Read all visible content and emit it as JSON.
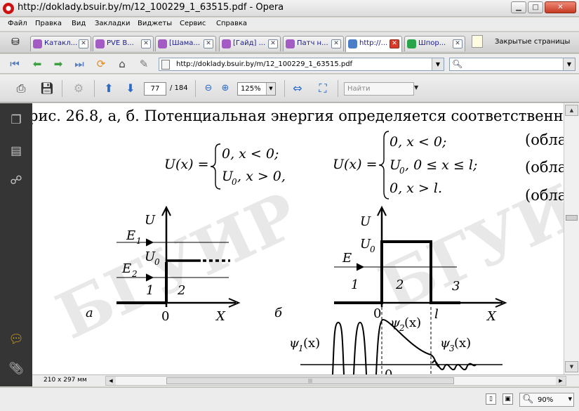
{
  "window": {
    "title": "http://doklady.bsuir.by/m/12_100229_1_63515.pdf - Opera"
  },
  "menu": [
    "Файл",
    "Правка",
    "Вид",
    "Закладки",
    "Виджеты",
    "Сервис",
    "Справка"
  ],
  "tabs": [
    {
      "label": "Катакл..."
    },
    {
      "label": "PVE В..."
    },
    {
      "label": "[Шама..."
    },
    {
      "label": "[Гайд] ..."
    },
    {
      "label": "Патч н..."
    },
    {
      "label": "http://..."
    },
    {
      "label": "Шпор..."
    }
  ],
  "closed_pages": {
    "label": "Закрытые страницы"
  },
  "address": {
    "url": "http://doklady.bsuir.by/m/12_100229_1_63515.pdf"
  },
  "pdf_toolbar": {
    "current_page": "77",
    "total_pages": "/ 184",
    "zoom": "125%",
    "find_placeholder": "Найти"
  },
  "document": {
    "top_line": "рис. 26.8, а, б. Потенциальная энергия определяется соответственн",
    "eq1_lhs": "U(x) =",
    "eq1_case1": "0,  x < 0;",
    "eq1_case2": "U",
    "eq1_case2_sub": "0",
    "eq1_case2_rest": ",  x > 0,",
    "eq2_lhs": "U(x) =",
    "eq2_case1": "0,  x < 0;",
    "eq2_case2": "U",
    "eq2_case2_sub": "0",
    "eq2_case2_rest": ",  0 ≤ x ≤ l;",
    "eq2_case3": "0,  x > l.",
    "region_label": "(обла",
    "figA": {
      "U": "U",
      "E1": "E",
      "E1_sub": "1",
      "U0": "U",
      "U0_sub": "0",
      "E2": "E",
      "E2_sub": "2",
      "r1": "1",
      "r2": "2",
      "zero": "0",
      "X": "X",
      "label": "а"
    },
    "figB": {
      "U": "U",
      "U0": "U",
      "U0_sub": "0",
      "E": "E",
      "r1": "1",
      "r2": "2",
      "r3": "3",
      "zero": "0",
      "l": "l",
      "X": "X",
      "label": "б",
      "psi1": "ψ",
      "psi1_sub": "1",
      "psi1_arg": "(x)",
      "psi2": "ψ",
      "psi2_sub": "2",
      "psi2_arg": "(x)",
      "psi3": "ψ",
      "psi3_sub": "3",
      "psi3_arg": "(x)",
      "zero2": "0"
    },
    "watermark": "БГУИР"
  },
  "bottom": {
    "page_size": "210 x 297 мм"
  },
  "status": {
    "zoom": "90%"
  }
}
